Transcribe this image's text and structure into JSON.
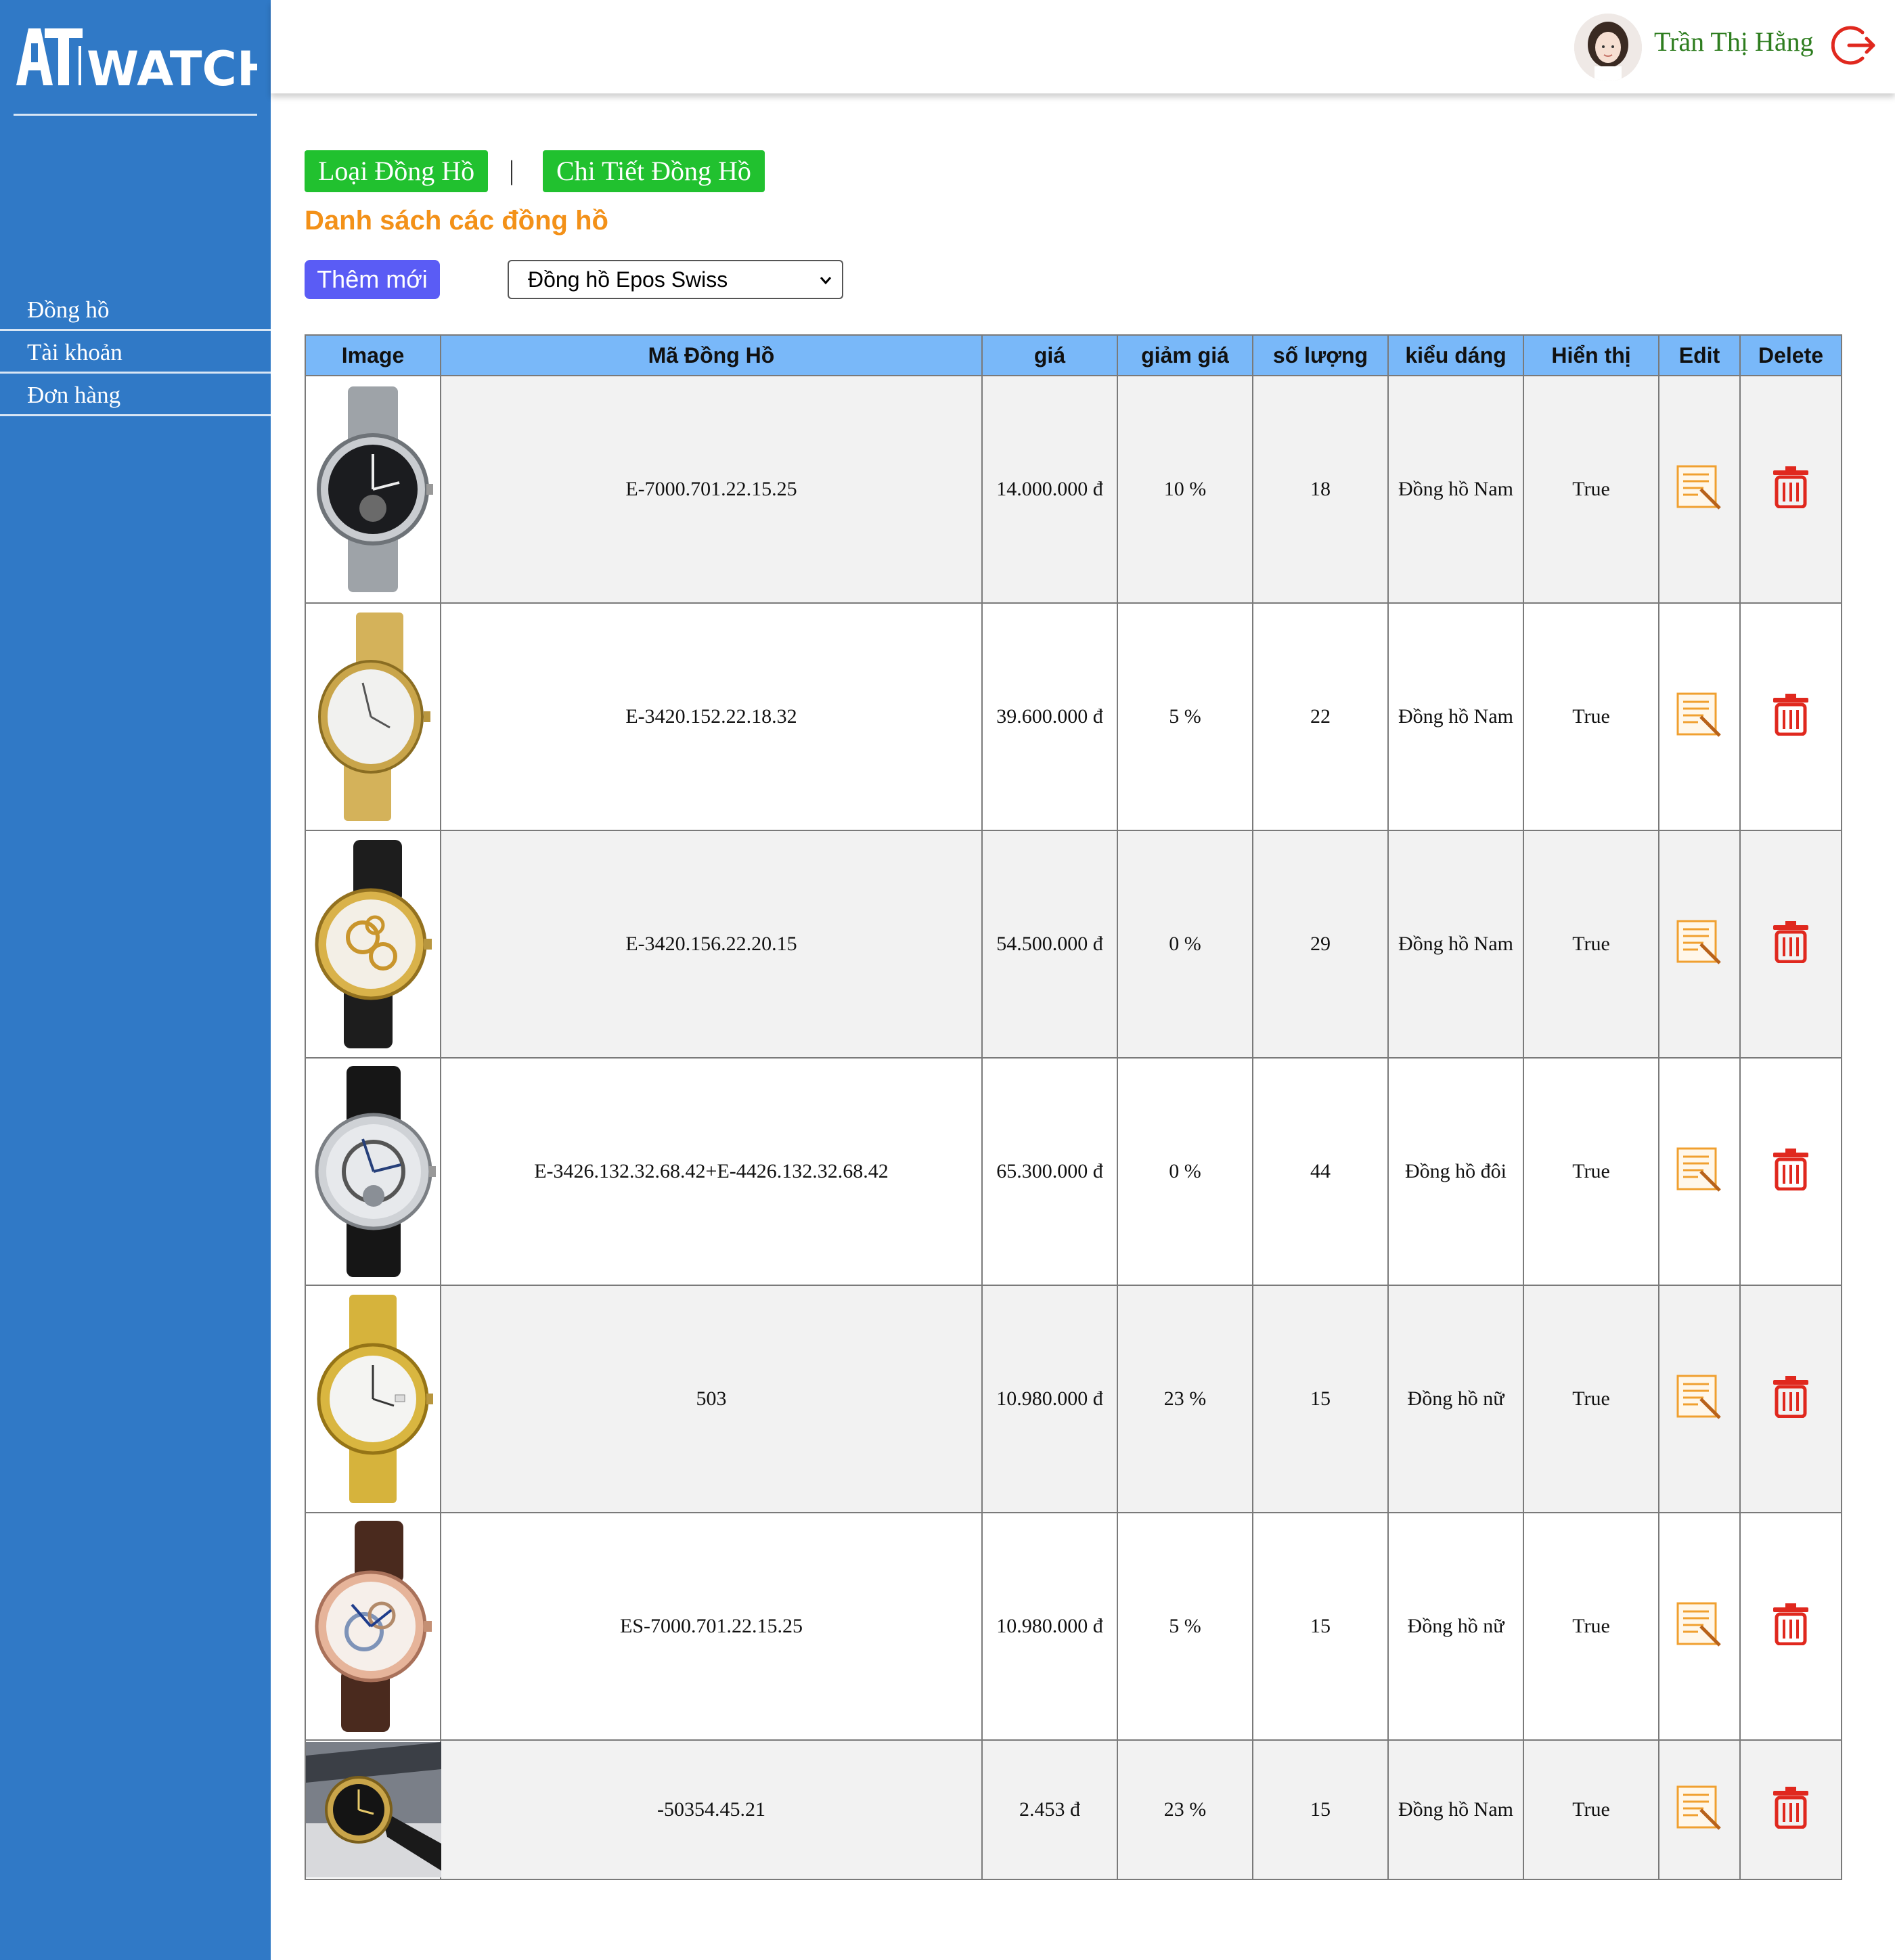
{
  "brand": {
    "logo_text": "ATWATCH"
  },
  "sidebar": {
    "items": [
      {
        "label": "Đồng hồ"
      },
      {
        "label": "Tài khoản"
      },
      {
        "label": "Đơn hàng"
      }
    ]
  },
  "header": {
    "username": "Trần Thị Hằng"
  },
  "tabs": {
    "category": "Loại Đồng Hồ",
    "separator": "|",
    "detail": "Chi Tiết Đồng Hồ"
  },
  "page": {
    "title": "Danh sách các đồng hồ",
    "add_button": "Thêm mới"
  },
  "filter": {
    "selected": "Đồng hồ Epos Swiss"
  },
  "table": {
    "columns": [
      "Image",
      "Mã Đồng Hồ",
      "giá",
      "giảm giá",
      "số lượng",
      "kiểu dáng",
      "Hiển thị",
      "Edit",
      "Delete"
    ],
    "rows": [
      {
        "code": "E-7000.701.22.15.25",
        "price": "14.000.000 đ",
        "discount": "10 %",
        "qty": "18",
        "style": "Đồng hồ Nam",
        "visible": "True"
      },
      {
        "code": "E-3420.152.22.18.32",
        "price": "39.600.000 đ",
        "discount": "5 %",
        "qty": "22",
        "style": "Đồng hồ Nam",
        "visible": "True"
      },
      {
        "code": "E-3420.156.22.20.15",
        "price": "54.500.000 đ",
        "discount": "0 %",
        "qty": "29",
        "style": "Đồng hồ Nam",
        "visible": "True"
      },
      {
        "code": "E-3426.132.32.68.42+E-4426.132.32.68.42",
        "price": "65.300.000 đ",
        "discount": "0 %",
        "qty": "44",
        "style": "Đồng hồ đôi",
        "visible": "True"
      },
      {
        "code": "503",
        "price": "10.980.000 đ",
        "discount": "23 %",
        "qty": "15",
        "style": "Đồng hồ nữ",
        "visible": "True"
      },
      {
        "code": "ES-7000.701.22.15.25",
        "price": "10.980.000 đ",
        "discount": "5 %",
        "qty": "15",
        "style": "Đồng hồ nữ",
        "visible": "True"
      },
      {
        "code": "-50354.45.21",
        "price": "2.453 đ",
        "discount": "23 %",
        "qty": "15",
        "style": "Đồng hồ Nam",
        "visible": "True"
      }
    ]
  },
  "colors": {
    "sidebar": "#3079c6",
    "header_row": "#79b8f9",
    "tab_button": "#21c12f",
    "add_button": "#5a5cf5",
    "title": "#f39118",
    "edit_icon": "#f0a030",
    "delete_icon": "#e0281e"
  },
  "icons": {
    "logout": "logout-icon",
    "edit": "edit-document-icon",
    "delete": "trash-icon",
    "dropdown": "chevron-down-icon"
  }
}
